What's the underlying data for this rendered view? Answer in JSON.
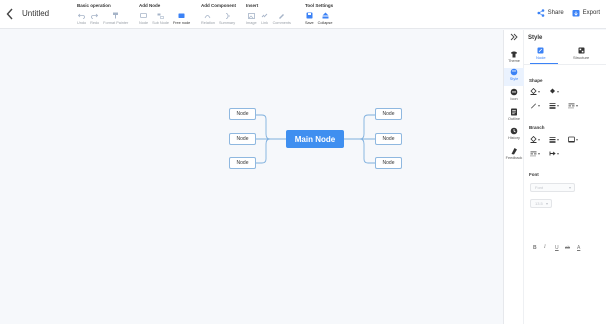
{
  "header": {
    "back_icon": "chevron-left-icon",
    "title": "Untitled",
    "share": "Share",
    "export": "Export"
  },
  "toolbar": {
    "groups": [
      {
        "title": "Basic operation",
        "buttons": [
          {
            "label": "Undo",
            "icon": "undo-icon"
          },
          {
            "label": "Redo",
            "icon": "redo-icon"
          },
          {
            "label": "Format Painter",
            "icon": "format-painter-icon"
          }
        ]
      },
      {
        "title": "Add Node",
        "buttons": [
          {
            "label": "Node",
            "icon": "node-icon"
          },
          {
            "label": "Sub Node",
            "icon": "sub-node-icon"
          },
          {
            "label": "Free node",
            "icon": "free-node-icon"
          }
        ]
      },
      {
        "title": "Add Component",
        "buttons": [
          {
            "label": "Relation",
            "icon": "relation-icon"
          },
          {
            "label": "Summary",
            "icon": "summary-icon"
          }
        ]
      },
      {
        "title": "Insert",
        "buttons": [
          {
            "label": "Image",
            "icon": "image-icon"
          },
          {
            "label": "Link",
            "icon": "link-icon"
          },
          {
            "label": "Comments",
            "icon": "comments-icon"
          }
        ]
      },
      {
        "title": "Tool Settings",
        "buttons": [
          {
            "label": "Save",
            "icon": "save-icon"
          },
          {
            "label": "Collapse",
            "icon": "collapse-icon"
          }
        ]
      }
    ]
  },
  "mindmap": {
    "main": "Main Node",
    "left_nodes": [
      "Node",
      "Node",
      "Node"
    ],
    "right_nodes": [
      "Node",
      "Node",
      "Node"
    ]
  },
  "rail": {
    "items": [
      {
        "label": "Theme",
        "icon": "theme-icon"
      },
      {
        "label": "Style",
        "icon": "style-icon"
      },
      {
        "label": "Icon",
        "icon": "emoji-icon"
      },
      {
        "label": "Outline",
        "icon": "outline-icon"
      },
      {
        "label": "History",
        "icon": "history-icon"
      },
      {
        "label": "Feedback",
        "icon": "feedback-icon"
      }
    ],
    "active": "Style"
  },
  "panel": {
    "title": "Style",
    "tabs": [
      "Node",
      "Structure"
    ],
    "active_tab": "Node",
    "sections": {
      "shape": "Shape",
      "branch": "Branch",
      "font": "Font"
    },
    "font_family": "Font",
    "font_size": "13.5",
    "format_buttons": [
      "B",
      "I",
      "U",
      "ab",
      "A"
    ]
  },
  "colors": {
    "accent": "#3f8ff0",
    "node_border": "#8fb8e0",
    "link": "#7fb0de"
  }
}
